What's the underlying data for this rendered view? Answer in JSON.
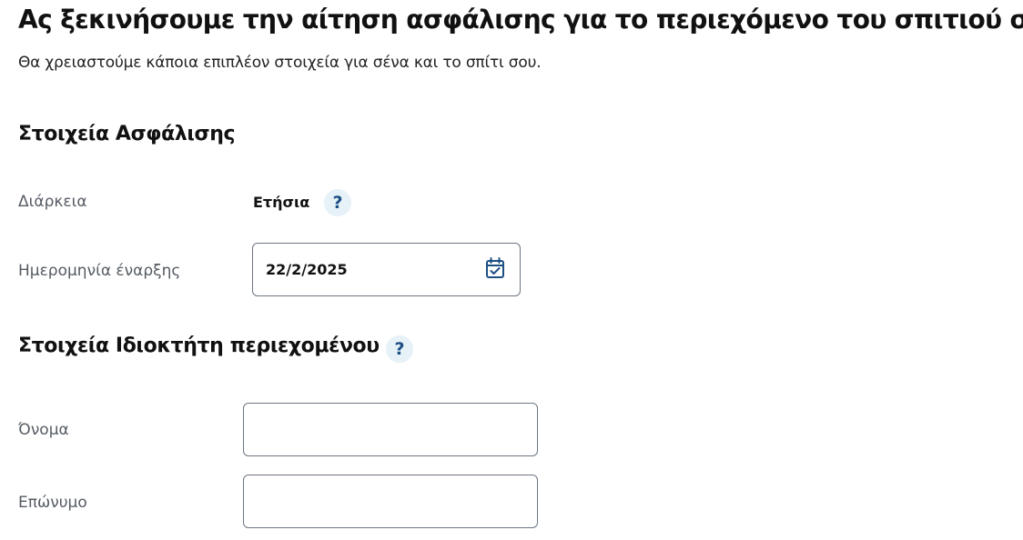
{
  "header": {
    "title": "Ας ξεκινήσουμε την αίτηση ασφάλισης για το περιεχόμενο του σπιτιού σου",
    "subtitle": "Θα χρειαστούμε κάποια επιπλέον στοιχεία για σένα και το σπίτι σου."
  },
  "insurance": {
    "section_title": "Στοιχεία Ασφάλισης",
    "duration_label": "Διάρκεια",
    "duration_value": "Ετήσια",
    "start_date_label": "Ημερομηνία έναρξης",
    "start_date_value": "22/2/2025",
    "help_glyph": "?"
  },
  "owner": {
    "section_title": "Στοιχεία Ιδιοκτήτη περιεχομένου",
    "help_glyph": "?",
    "first_name_label": "Όνομα",
    "first_name_value": "",
    "last_name_label": "Επώνυμο",
    "last_name_value": ""
  },
  "colors": {
    "accent": "#1c4f83",
    "help_bg": "#e6f1f8",
    "border": "#6d7682",
    "label": "#555b63"
  },
  "icons": {
    "help": "help-icon",
    "calendar": "calendar-check-icon"
  }
}
